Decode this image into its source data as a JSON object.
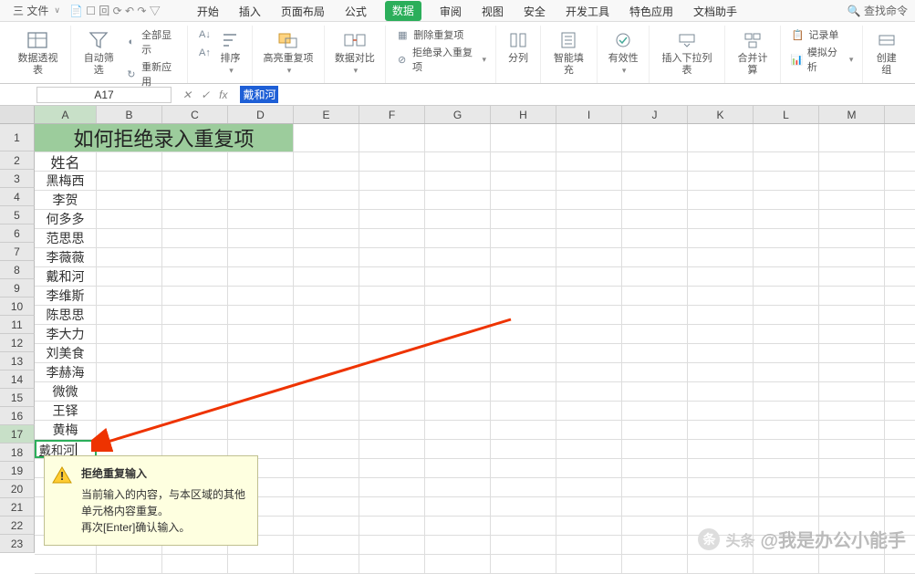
{
  "topbar": {
    "file_prefix": "三 文件",
    "menu": [
      "开始",
      "插入",
      "页面布局",
      "公式",
      "数据",
      "审阅",
      "视图",
      "安全",
      "开发工具",
      "特色应用",
      "文档助手"
    ],
    "active_index": 4,
    "search": "查找命令"
  },
  "ribbon": {
    "grp_pivot": "数据透视表",
    "grp_autofilter": "自动筛选",
    "grp_showall": "全部显示",
    "grp_reapply": "重新应用",
    "grp_sort_asc_ico": "A↓",
    "grp_sort_dsc_ico": "A↑",
    "grp_sort": "排序",
    "grp_highlight_dup": "高亮重复项",
    "grp_data_compare": "数据对比",
    "grp_delete_dup": "删除重复项",
    "grp_reject_dup": "拒绝录入重复项",
    "grp_text_to_cols": "分列",
    "grp_smart_fill": "智能填充",
    "grp_validity": "有效性",
    "grp_insert_dropdown": "插入下拉列表",
    "grp_consolidate": "合并计算",
    "grp_record_form": "记录单",
    "grp_what_if": "模拟分析",
    "grp_create_group": "创建组"
  },
  "formula_bar": {
    "name_box": "A17",
    "input_value": "戴和河"
  },
  "columns": [
    "A",
    "B",
    "C",
    "D",
    "E",
    "F",
    "G",
    "H",
    "I",
    "J",
    "K",
    "L",
    "M"
  ],
  "row_count": 23,
  "title_cell": "如何拒绝录入重复项",
  "header_cell": "姓名",
  "names": [
    "黑梅西",
    "李贺",
    "何多多",
    "范思思",
    "李薇薇",
    "戴和河",
    "李维斯",
    "陈思思",
    "李大力",
    "刘美食",
    "李赫海",
    "微微",
    "王铎",
    "黄梅"
  ],
  "editing_value": "戴和河",
  "editing_row": 17,
  "tooltip": {
    "title": "拒绝重复输入",
    "line1": "当前输入的内容，与本区域的其他单元格内容重复。",
    "line2": "再次[Enter]确认输入。"
  },
  "watermark": {
    "prefix": "头条",
    "text": "@我是办公小能手"
  }
}
